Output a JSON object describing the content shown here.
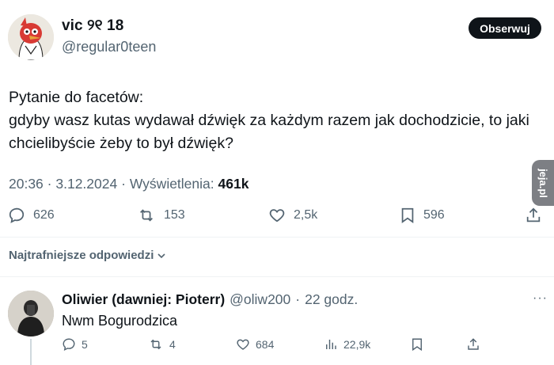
{
  "tweet": {
    "author": {
      "display_name": "vic ୨୧ 18",
      "handle": "@regular0teen"
    },
    "follow_label": "Obserwuj",
    "text": "Pytanie do facetów:\n gdyby wasz kutas wydawał dźwięk za każdym razem jak dochodzicie, to jaki chcielibyście żeby to był dźwięk?",
    "time": "20:36",
    "date": "3.12.2024",
    "views_label": "Wyświetlenia:",
    "views": "461k",
    "sep": "·",
    "stats": {
      "replies": "626",
      "retweets": "153",
      "likes": "2,5k",
      "bookmarks": "596"
    }
  },
  "watermark": {
    "text": "jeja.pl"
  },
  "sort": {
    "label": "Najtrafniejsze odpowiedzi"
  },
  "reply": {
    "display_name": "Oliwier (dawniej: Pioterr)",
    "handle": "@oliw200",
    "time": "22 godz.",
    "text": "Nwm Bogurodzica",
    "more": "···",
    "stats": {
      "replies": "5",
      "retweets": "4",
      "likes": "684",
      "views": "22,9k"
    }
  },
  "colors": {
    "text": "#0f1419",
    "muted": "#536471",
    "button_bg": "#0f1419",
    "divider": "#eff3f4"
  }
}
